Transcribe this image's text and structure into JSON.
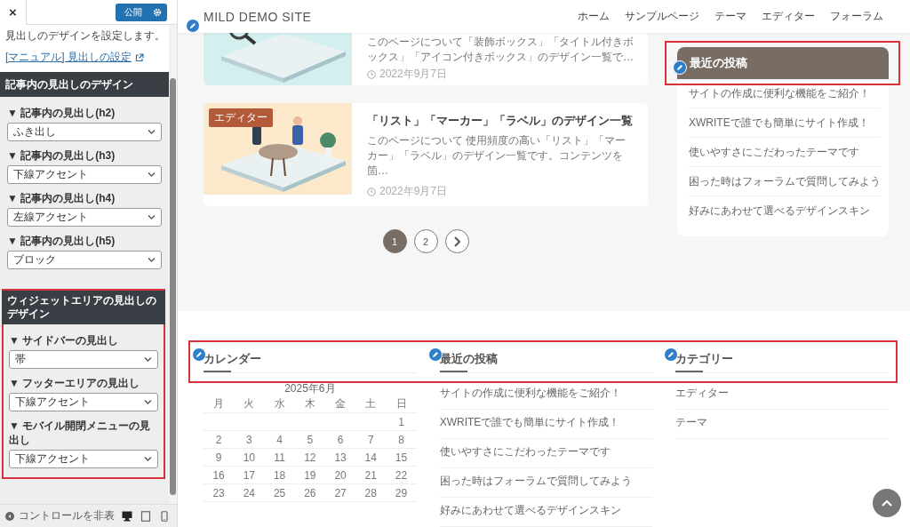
{
  "customizer": {
    "close": "×",
    "publish": "公開",
    "description": "見出しのデザインを設定します。",
    "manual_link": "[マニュアル] 見出しの設定",
    "sections": [
      {
        "title": "記事内の見出しのデザイン",
        "highlighted": false,
        "controls": [
          {
            "label": "▼ 記事内の見出し(h2)",
            "value": "ふき出し"
          },
          {
            "label": "▼ 記事内の見出し(h3)",
            "value": "下線アクセント"
          },
          {
            "label": "▼ 記事内の見出し(h4)",
            "value": "左線アクセント"
          },
          {
            "label": "▼ 記事内の見出し(h5)",
            "value": "ブロック"
          }
        ]
      },
      {
        "title": "ウィジェットエリアの見出しのデザイン",
        "highlighted": true,
        "controls": [
          {
            "label": "▼ サイドバーの見出し",
            "value": "帯"
          },
          {
            "label": "▼ フッターエリアの見出し",
            "value": "下線アクセント"
          },
          {
            "label": "▼ モバイル開閉メニューの見出し",
            "value": "下線アクセント"
          }
        ]
      }
    ],
    "footer": {
      "hide_controls": "コントロールを非表",
      "devices": [
        {
          "kind": "desktop",
          "selected": true
        },
        {
          "kind": "tablet",
          "selected": false
        },
        {
          "kind": "mobile",
          "selected": false
        }
      ]
    }
  },
  "site": {
    "title": "MILD DEMO SITE",
    "nav": [
      "ホーム",
      "サンプルページ",
      "テーマ",
      "エディター",
      "フォーラム"
    ],
    "posts": [
      {
        "excerpt": "このページについて「装飾ボックス」「タイトル付きボックス」「アイコン付きボックス」のデザイン一覧で…",
        "date": "2022年9月7日"
      },
      {
        "category": "エディター",
        "title": "「リスト」「マーカー」「ラベル」のデザイン一覧",
        "excerpt": "このページについて 使用頻度の高い「リスト」「マーカー」「ラベル」のデザイン一覧です。コンテンツを箇…",
        "date": "2022年9月7日"
      }
    ],
    "pagination": {
      "pages": [
        {
          "label": "1",
          "selected": true
        },
        {
          "label": "2",
          "selected": false
        }
      ],
      "has_next": true
    },
    "sidebar_widget": {
      "title": "最近の投稿",
      "highlighted": true,
      "items": [
        "サイトの作成に便利な機能をご紹介！",
        "XWRITEで誰でも簡単にサイト作成！",
        "使いやすさにこだわったテーマです",
        "困った時はフォーラムで質問してみよう",
        "好みにあわせて選べるデザインスキン"
      ]
    },
    "footer_highlighted": true,
    "footer_widgets": [
      {
        "kind": "calendar",
        "title": "カレンダー",
        "caption": "2025年6月",
        "weekdays": [
          "月",
          "火",
          "水",
          "木",
          "金",
          "土",
          "日"
        ],
        "weeks": [
          [
            "1"
          ],
          [
            "2",
            "3",
            "4",
            "5",
            "6",
            "7",
            "8"
          ],
          [
            "9",
            "10",
            "11",
            "12",
            "13",
            "14",
            "15"
          ],
          [
            "16",
            "17",
            "18",
            "19",
            "20",
            "21",
            "22"
          ],
          [
            "23",
            "24",
            "25",
            "26",
            "27",
            "28",
            "29"
          ]
        ]
      },
      {
        "kind": "list",
        "title": "最近の投稿",
        "items": [
          "サイトの作成に便利な機能をご紹介！",
          "XWRITEで誰でも簡単にサイト作成！",
          "使いやすさにこだわったテーマです",
          "困った時はフォーラムで質問してみよう",
          "好みにあわせて選べるデザインスキン"
        ]
      },
      {
        "kind": "list",
        "title": "カテゴリー",
        "items": [
          "エディター",
          "テーマ"
        ]
      }
    ]
  }
}
